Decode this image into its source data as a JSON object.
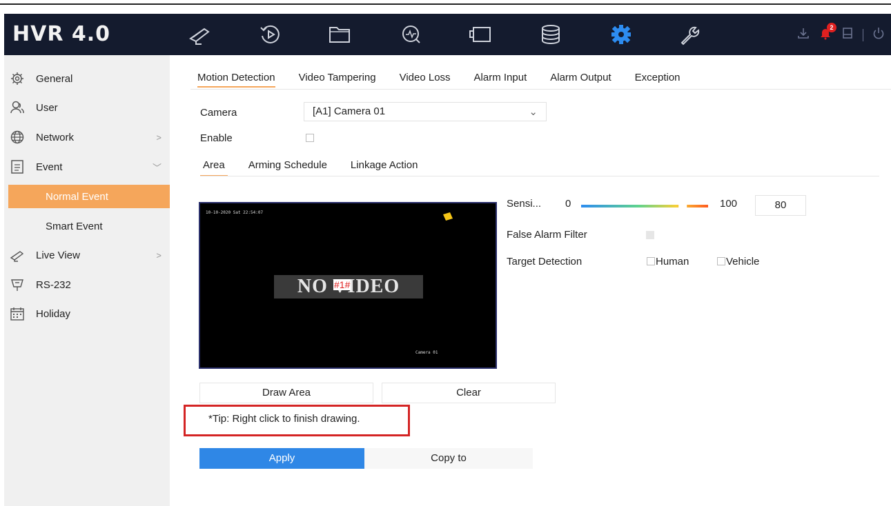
{
  "app": {
    "title": "HVR 4.0",
    "accent": "#f5a65b",
    "topbar_bg": "#141b2e",
    "apply_color": "#2f87e6"
  },
  "topnav": {
    "icons": [
      "live-view-icon",
      "playback-icon",
      "file-management-icon",
      "smart-analysis-icon",
      "camera-icon",
      "storage-icon",
      "configuration-icon",
      "maintenance-icon"
    ],
    "active": "configuration-icon",
    "right_icons": [
      "download-icon",
      "alarm-bell-icon",
      "log-icon",
      "power-icon"
    ],
    "alarm_count": "2"
  },
  "sidebar": {
    "items": [
      {
        "label": "General",
        "icon": "gear-icon"
      },
      {
        "label": "User",
        "icon": "user-icon"
      },
      {
        "label": "Network",
        "icon": "globe-icon",
        "chevron": ">"
      },
      {
        "label": "Event",
        "icon": "event-icon",
        "chevron": "﹀"
      },
      {
        "label": "Live View",
        "icon": "live-view-icon",
        "chevron": ">"
      },
      {
        "label": "RS-232",
        "icon": "rs232-icon"
      },
      {
        "label": "Holiday",
        "icon": "calendar-icon"
      }
    ],
    "subitems": [
      {
        "label": "Normal Event",
        "active": true
      },
      {
        "label": "Smart Event",
        "active": false
      }
    ]
  },
  "main": {
    "tabs": [
      "Motion Detection",
      "Video Tampering",
      "Video Loss",
      "Alarm Input",
      "Alarm Output",
      "Exception"
    ],
    "active_tab": "Motion Detection",
    "camera_label": "Camera",
    "camera_value": "[A1] Camera 01",
    "enable_label": "Enable",
    "enable_checked": false,
    "subtabs": [
      "Area",
      "Arming Schedule",
      "Linkage Action"
    ],
    "active_subtab": "Area",
    "video": {
      "timestamp": "10-10-2020 Sat 22:54:07",
      "no_video": "NO VIDEO",
      "channel": "#1#",
      "camera_name": "Camera 01"
    },
    "sensitivity": {
      "label": "Sensi...",
      "min": "0",
      "max": "100",
      "value": "80",
      "level": 0.8
    },
    "false_alarm_label": "False Alarm Filter",
    "target_detection_label": "Target Detection",
    "human_label": "Human",
    "vehicle_label": "Vehicle",
    "draw_area_label": "Draw Area",
    "clear_label": "Clear",
    "tip": "*Tip: Right click to finish drawing.",
    "apply_label": "Apply",
    "copy_to_label": "Copy to"
  }
}
